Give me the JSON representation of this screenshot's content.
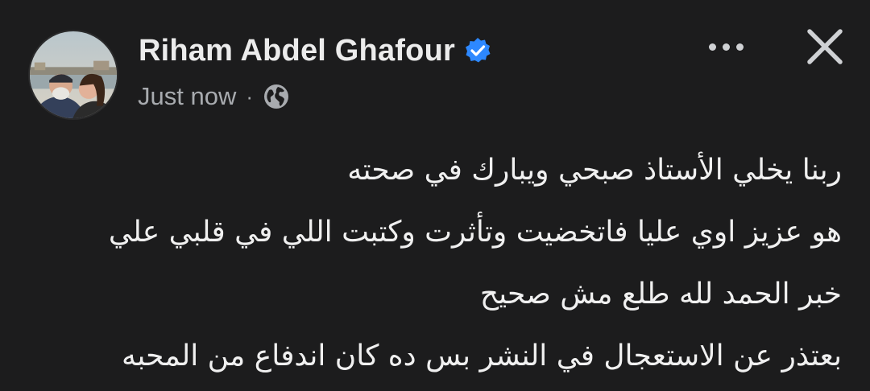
{
  "post": {
    "author_name": "Riham Abdel Ghafour",
    "timestamp": "Just now",
    "separator": "·",
    "audience_icon": "globe-icon",
    "verified_icon": "verified-badge-icon",
    "more_icon": "more-options-icon",
    "close_icon": "close-icon",
    "colors": {
      "background": "#1c1c1d",
      "name": "#ececec",
      "meta": "#a8abaf",
      "verified": "#2d88ff",
      "text": "#f0f0f0"
    },
    "lines": [
      "ربنا يخلي الأستاذ صبحي ويبارك في صحته",
      "هو عزيز اوي عليا فاتخضيت وتأثرت وكتبت اللي في قلبي علي",
      "خبر الحمد لله طلع مش صحيح",
      "بعتذر عن الاستعجال في النشر بس ده كان اندفاع من المحبه"
    ]
  }
}
